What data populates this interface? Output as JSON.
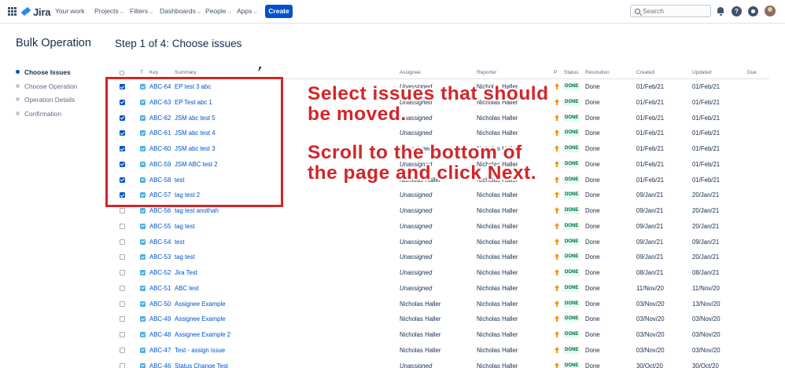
{
  "nav": {
    "logo_text": "Jira",
    "items": [
      "Your work",
      "Projects",
      "Filters",
      "Dashboards",
      "People",
      "Apps"
    ],
    "create_label": "Create",
    "search_placeholder": "Search"
  },
  "sidebar": {
    "title": "Bulk Operation",
    "steps": [
      {
        "label": "Choose Issues",
        "active": true
      },
      {
        "label": "Choose Operation",
        "active": false
      },
      {
        "label": "Operation Details",
        "active": false
      },
      {
        "label": "Confirmation",
        "active": false
      }
    ]
  },
  "main": {
    "step_title": "Step 1 of 4: Choose issues",
    "columns": [
      "T",
      "Key",
      "Summary",
      "Assignee",
      "Reporter",
      "P",
      "Status",
      "Resolution",
      "Created",
      "Updated",
      "Due"
    ],
    "rows": [
      {
        "checked": true,
        "key": "ABC-64",
        "summary": "EP test 3 abc",
        "assignee": "Unassigned",
        "reporter": "Nicholas Haller",
        "status": "DONE",
        "resolution": "Done",
        "created": "01/Feb/21",
        "updated": "01/Feb/21"
      },
      {
        "checked": true,
        "key": "ABC-63",
        "summary": "EP Test abc 1",
        "assignee": "Unassigned",
        "reporter": "Nicholas Haller",
        "status": "DONE",
        "resolution": "Done",
        "created": "01/Feb/21",
        "updated": "01/Feb/21"
      },
      {
        "checked": true,
        "key": "ABC-62",
        "summary": "JSM abc test 5",
        "assignee": "Unassigned",
        "reporter": "Nicholas Haller",
        "status": "DONE",
        "resolution": "Done",
        "created": "01/Feb/21",
        "updated": "01/Feb/21"
      },
      {
        "checked": true,
        "key": "ABC-61",
        "summary": "JSM abc test 4",
        "assignee": "Unassigned",
        "reporter": "Nicholas Haller",
        "status": "DONE",
        "resolution": "Done",
        "created": "01/Feb/21",
        "updated": "01/Feb/21"
      },
      {
        "checked": true,
        "key": "ABC-60",
        "summary": "JSM abc test 3",
        "assignee": "Unassigned",
        "reporter": "Nicholas Haller",
        "status": "DONE",
        "resolution": "Done",
        "created": "01/Feb/21",
        "updated": "01/Feb/21"
      },
      {
        "checked": true,
        "key": "ABC-59",
        "summary": "JSM ABC test 2",
        "assignee": "Unassigned",
        "reporter": "Nicholas Haller",
        "status": "DONE",
        "resolution": "Done",
        "created": "01/Feb/21",
        "updated": "01/Feb/21"
      },
      {
        "checked": true,
        "key": "ABC-58",
        "summary": "test",
        "assignee": "Nicholas Haller",
        "reporter": "Nicholas Haller",
        "status": "DONE",
        "resolution": "Done",
        "created": "01/Feb/21",
        "updated": "01/Feb/21"
      },
      {
        "checked": true,
        "key": "ABC-57",
        "summary": "tag test 2",
        "assignee": "Unassigned",
        "reporter": "Nicholas Haller",
        "status": "DONE",
        "resolution": "Done",
        "created": "09/Jan/21",
        "updated": "20/Jan/21"
      },
      {
        "checked": false,
        "key": "ABC-56",
        "summary": "tag test anothah",
        "assignee": "Unassigned",
        "reporter": "Nicholas Haller",
        "status": "DONE",
        "resolution": "Done",
        "created": "09/Jan/21",
        "updated": "20/Jan/21"
      },
      {
        "checked": false,
        "key": "ABC-55",
        "summary": "tag test",
        "assignee": "Unassigned",
        "reporter": "Nicholas Haller",
        "status": "DONE",
        "resolution": "Done",
        "created": "09/Jan/21",
        "updated": "20/Jan/21"
      },
      {
        "checked": false,
        "key": "ABC-54",
        "summary": "test",
        "assignee": "Unassigned",
        "reporter": "Nicholas Haller",
        "status": "DONE",
        "resolution": "Done",
        "created": "09/Jan/21",
        "updated": "09/Jan/21"
      },
      {
        "checked": false,
        "key": "ABC-53",
        "summary": "tag test",
        "assignee": "Unassigned",
        "reporter": "Nicholas Haller",
        "status": "DONE",
        "resolution": "Done",
        "created": "09/Jan/21",
        "updated": "20/Jan/21"
      },
      {
        "checked": false,
        "key": "ABC-52",
        "summary": "Jira Test",
        "assignee": "Unassigned",
        "reporter": "Nicholas Haller",
        "status": "DONE",
        "resolution": "Done",
        "created": "08/Jan/21",
        "updated": "08/Jan/21"
      },
      {
        "checked": false,
        "key": "ABC-51",
        "summary": "ABC test",
        "assignee": "Unassigned",
        "reporter": "Nicholas Haller",
        "status": "DONE",
        "resolution": "Done",
        "created": "11/Nov/20",
        "updated": "11/Nov/20"
      },
      {
        "checked": false,
        "key": "ABC-50",
        "summary": "Assignee Example",
        "assignee": "Nicholas Haller",
        "reporter": "Nicholas Haller",
        "status": "DONE",
        "resolution": "Done",
        "created": "03/Nov/20",
        "updated": "13/Nov/20"
      },
      {
        "checked": false,
        "key": "ABC-49",
        "summary": "Assignee Example",
        "assignee": "Nicholas Haller",
        "reporter": "Nicholas Haller",
        "status": "DONE",
        "resolution": "Done",
        "created": "03/Nov/20",
        "updated": "03/Nov/20"
      },
      {
        "checked": false,
        "key": "ABC-48",
        "summary": "Assignee Example 2",
        "assignee": "Nicholas Haller",
        "reporter": "Nicholas Haller",
        "status": "DONE",
        "resolution": "Done",
        "created": "03/Nov/20",
        "updated": "03/Nov/20"
      },
      {
        "checked": false,
        "key": "ABC-47",
        "summary": "Test - assign issue",
        "assignee": "Nicholas Haller",
        "reporter": "Nicholas Haller",
        "status": "DONE",
        "resolution": "Done",
        "created": "03/Nov/20",
        "updated": "03/Nov/20"
      },
      {
        "checked": false,
        "key": "ABC-46",
        "summary": "Status Change Test",
        "assignee": "Unassigned",
        "reporter": "Nicholas Haller",
        "status": "DONE",
        "resolution": "Done",
        "created": "30/Oct/20",
        "updated": "30/Oct/20"
      }
    ]
  },
  "annotations": {
    "callout_1": [
      "Select issues that should",
      "be moved."
    ],
    "callout_2": [
      "Scroll to the bottom of",
      "the page and click Next."
    ],
    "color": "#D1262A"
  },
  "colors": {
    "primary": "#0052CC",
    "done_bg": "#E3FCEF",
    "done_text": "#006644",
    "priority": "#FF8B00"
  }
}
